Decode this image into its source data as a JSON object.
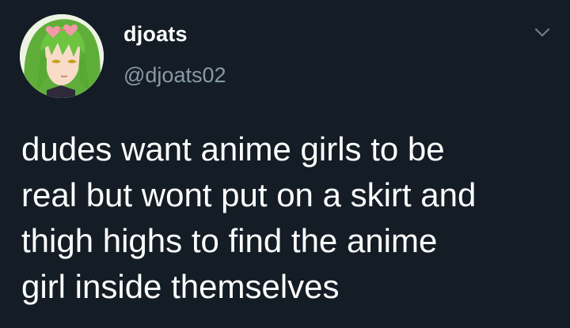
{
  "colors": {
    "background": "#141d26",
    "text": "#ffffff",
    "secondary_text": "#8899a6"
  },
  "author": {
    "display_name": "djoats",
    "handle": "@djoats02",
    "avatar_icon": "anime-girl-avatar"
  },
  "menu_icon": "chevron-down-icon",
  "tweet": {
    "lines": [
      "dudes want anime girls to be",
      "real but wont put on a skirt and",
      "thigh highs to find the anime",
      "girl inside themselves"
    ]
  }
}
